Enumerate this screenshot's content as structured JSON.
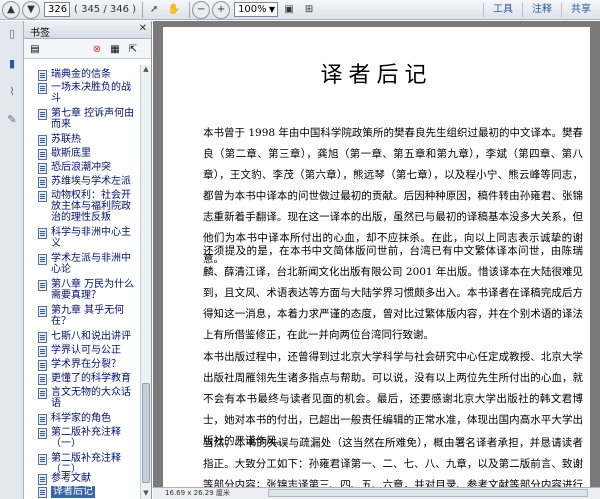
{
  "toolbar": {
    "page_value": "326",
    "page_count": "( 345 / 346 )",
    "zoom_value": "100%",
    "tools_label": "工具",
    "comment_label": "注释",
    "share_label": "共享"
  },
  "panel": {
    "title": "书签"
  },
  "bookmarks": [
    "瑞典金的信条",
    "一场未决胜负的战斗",
    "第七章 控诉声何由而来",
    "苏联热",
    "歇斯底里",
    "恐后浪潮冲突",
    "苏维埃与学术左派",
    "动物权利：社会开放主体与福利院政治的理性反叛",
    "科学与非洲中心主义",
    "学术左派与非洲中心论",
    "第八章 万民为什么需要真理？",
    "第九章 其乎无何在？",
    "七斯八和说出讲评",
    "学界认可与公正",
    "学术界在分裂？",
    "更懂了的科学教育",
    "言文无物的大众话语",
    "科学家的角色",
    "第二版补充注释（一）",
    "第二版补充注释（二）",
    "参考文献",
    "译者后记"
  ],
  "document": {
    "title": "译者后记",
    "paragraphs": [
      "本书曾于 1998 年由中国科学院政策所的樊春良先生组织过最初的中文译本。樊春良（第二章、第三章），龚旭（第一章、第五章和第九章），李斌（第四章、第八章），王文豹、李茂（第六章），熊远琴（第七章），以及程小宁、熊云峰等同志，都曾为本书中译本的问世做过最初的贡献。后因种种原因，稿件转由孙雍君、张锦志重新着手翻译。现在这一译本的出版，虽然已与最初的译稿基本没多大关系，但他们为本书中译本所付出的心血，却不应抹杀。在此，向以上同志表示诚挚的谢意。",
      "还须提及的是，在本书中文简体版问世前，台湾已有中文繁体译本问世，由陈瑞麟、薛清江译，台北新闻文化出版有限公司 2001 年出版。惜该译本在大陆很难见到，且文风、术语表达等方面与大陆学界习惯颇多出入。本书译者在译稿完成后方得知这一消息，本着力求严谨的态度，曾对比过繁体版内容，并在个别术语的译法上有所借鉴修正，在此一并向两位台湾同行致谢。",
      "本书出版过程中，还曾得到过北京大学科学与社会研究中心任定成教授、北京大学出版社周雁翎先生诸多指点与帮助。可以说，没有以上两位先生所付出的心血，就不会有本书最终与读者见面的机会。最后，还要感谢北京大学出版社的韩文君博士，她对本书的付出，已超出一般责任编辑的正常水准，体现出国内高水平大学出版社的严谨作风。",
      "当然，本书的失误与疏漏处（这当然在所难免），概由署名译者承担，并恳请读者指正。大致分工如下：孙雍君译第一、二、七、八、九章，以及第二版前言、致谢等部分内容；张锦志译第三、四、五、六章，并对目录、参考文献等部分内容进行整理及译校。"
    ]
  },
  "status": {
    "page_size": "16.69 x 26.29 厘米"
  },
  "colors": {
    "bookmark_text": "#00126b",
    "selected_bg": "#3a65a8",
    "toolbar_link": "#2a5b9c"
  }
}
